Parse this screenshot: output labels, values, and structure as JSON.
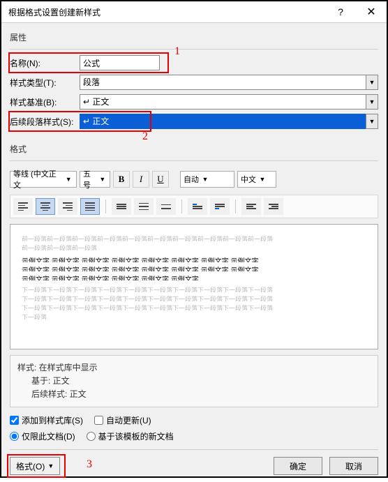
{
  "title": "根据格式设置创建新样式",
  "sections": {
    "properties": "属性",
    "format": "格式"
  },
  "labels": {
    "name": "名称(N):",
    "styleType": "样式类型(T):",
    "basedOn": "样式基准(B):",
    "nextStyle": "后续段落样式(S):"
  },
  "values": {
    "name": "公式",
    "styleType": "段落",
    "basedOn": "↵ 正文",
    "nextStyle": "↵ 正文"
  },
  "fontBar": {
    "font": "等线 (中文正文",
    "size": "五号",
    "bold": "B",
    "italic": "I",
    "underline": "U",
    "autoColor": "自动",
    "script": "中文"
  },
  "preview": {
    "grayBefore": "前一段落前一段落前一段落前一段落前一段落前一段落前一段落前一段落前一段落前一段落",
    "grayBefore2": "前一段落前一段落前一段落",
    "sample1": "示例文字 示例文字 示例文字 示例文字 示例文字 示例文字 示例文字 示例文字",
    "sample2": "示例文字 示例文字 示例文字 示例文字 示例文字 示例文字 示例文字 示例文字",
    "sample3": "示例文字 示例文字 示例文字 示例文字 示例文字 示例文字",
    "grayAfter": "下一段落下一段落下一段落下一段落下一段落下一段落下一段落下一段落下一段落下一段落",
    "grayAfter2": "下一段落下一段落下一段落下一段落下一段落下一段落下一段落下一段落下一段落下一段落",
    "grayAfter3": "下一段落下一段落下一段落下一段落下一段落下一段落下一段落下一段落下一段落下一段落",
    "grayAfter4": "下一段落"
  },
  "desc": {
    "l1": "样式: 在样式库中显示",
    "l2": "基于: 正文",
    "l3": "后续样式: 正文"
  },
  "checkboxes": {
    "addToGallery": "添加到样式库(S)",
    "autoUpdate": "自动更新(U)"
  },
  "radios": {
    "thisDoc": "仅限此文档(D)",
    "template": "基于该模板的新文档"
  },
  "footer": {
    "format": "格式(O)",
    "ok": "确定",
    "cancel": "取消"
  },
  "annotations": {
    "a1": "1",
    "a2": "2",
    "a3": "3"
  }
}
